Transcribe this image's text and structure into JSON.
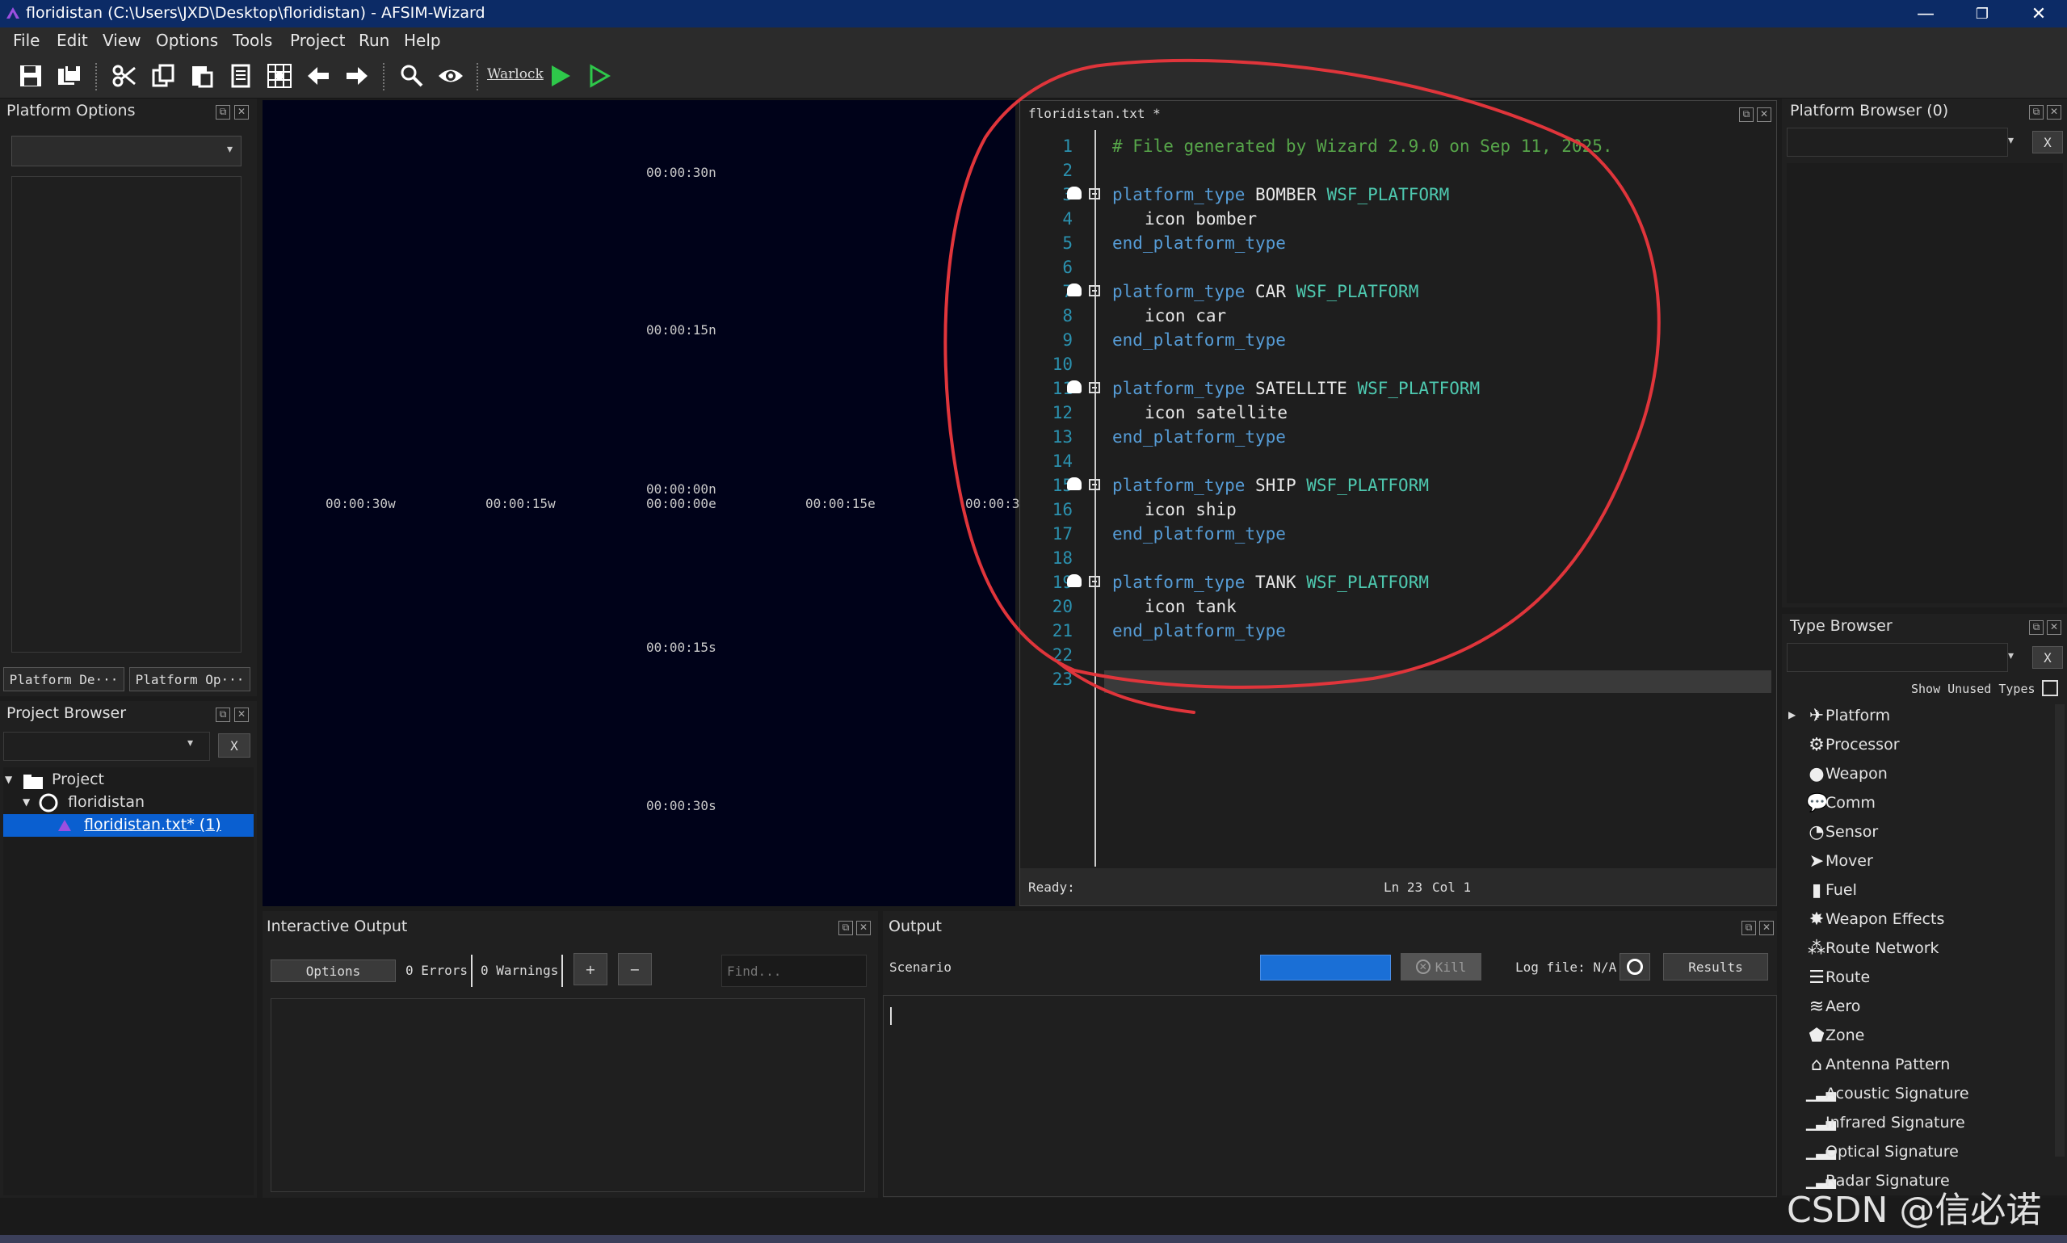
{
  "window": {
    "title": "floridistan (C:\\Users\\JXD\\Desktop\\floridistan) - AFSIM-Wizard",
    "minimize": "—",
    "restore": "❐",
    "close": "✕"
  },
  "menu": [
    "File",
    "Edit",
    "View",
    "Options",
    "Tools",
    "Project",
    "Run",
    "Help"
  ],
  "toolbar": {
    "warlock": "Warlock"
  },
  "platform_options": {
    "title": "Platform Options",
    "tabs": [
      "Platform De···",
      "Platform Op···"
    ]
  },
  "project_browser": {
    "title": "Project Browser",
    "clear": "X",
    "tree": {
      "root": "Project",
      "project": "floridistan",
      "file": "floridistan.txt* (1)"
    }
  },
  "map": {
    "labels": {
      "n30": "00:00:30n",
      "n15": "00:00:15n",
      "n0": "00:00:00n",
      "e0": "00:00:00e",
      "w30": "00:00:30w",
      "w15": "00:00:15w",
      "e15": "00:00:15e",
      "e30": "00:00:3",
      "s15": "00:00:15s",
      "s30": "00:00:30s"
    }
  },
  "editor": {
    "tab": "floridistan.txt *",
    "lines": [
      "1",
      "2",
      "3",
      "4",
      "5",
      "6",
      "7",
      "8",
      "9",
      "10",
      "11",
      "12",
      "13",
      "14",
      "15",
      "16",
      "17",
      "18",
      "19",
      "20",
      "21",
      "22",
      "23"
    ],
    "comment": "# File generated by Wizard 2.9.0 on Sep 11, 2025.",
    "kw_platform_type": "platform_type",
    "kw_end": "end_platform_type",
    "kw_icon": "icon",
    "base": "WSF_PLATFORM",
    "types": [
      {
        "name": "BOMBER",
        "icon": "bomber"
      },
      {
        "name": "CAR",
        "icon": "car"
      },
      {
        "name": "SATELLITE",
        "icon": "satellite"
      },
      {
        "name": "SHIP",
        "icon": "ship"
      },
      {
        "name": "TANK",
        "icon": "tank"
      }
    ],
    "status": {
      "ready": "Ready:",
      "ln": "Ln 23",
      "col": "Col 1"
    }
  },
  "platform_browser": {
    "title": "Platform Browser (0)",
    "clear": "X"
  },
  "type_browser": {
    "title": "Type Browser",
    "clear": "X",
    "show_unused": "Show Unused Types",
    "items": [
      {
        "label": "Platform",
        "icon": "plane-icon"
      },
      {
        "label": "Processor",
        "icon": "gears-icon"
      },
      {
        "label": "Weapon",
        "icon": "bomb-icon"
      },
      {
        "label": "Comm",
        "icon": "speech-bubble-icon"
      },
      {
        "label": "Sensor",
        "icon": "radar-dish-icon"
      },
      {
        "label": "Mover",
        "icon": "jet-icon"
      },
      {
        "label": "Fuel",
        "icon": "fuel-can-icon"
      },
      {
        "label": "Weapon Effects",
        "icon": "explosion-icon"
      },
      {
        "label": "Route Network",
        "icon": "network-icon"
      },
      {
        "label": "Route",
        "icon": "route-icon"
      },
      {
        "label": "Aero",
        "icon": "aero-icon"
      },
      {
        "label": "Zone",
        "icon": "pentagon-icon"
      },
      {
        "label": "Antenna Pattern",
        "icon": "house-icon"
      },
      {
        "label": "Acoustic Signature",
        "icon": "bars-icon"
      },
      {
        "label": "Infrared Signature",
        "icon": "bars-icon"
      },
      {
        "label": "Optical Signature",
        "icon": "bars-icon"
      },
      {
        "label": "Radar Signature",
        "icon": "bars-icon"
      }
    ]
  },
  "interactive_output": {
    "title": "Interactive Output",
    "options": "Options",
    "errors": "0 Errors",
    "warnings": "0 Warnings",
    "plus": "+",
    "minus": "−",
    "find_placeholder": "Find..."
  },
  "output": {
    "title": "Output",
    "scenario": "Scenario",
    "kill": "Kill",
    "logfile": "Log file: N/A",
    "results": "Results"
  },
  "watermark": "CSDN @信必诺",
  "colors": {
    "accent": "#1a6fd6",
    "annotation": "#e0353b",
    "titlebar": "#0c2b66"
  }
}
